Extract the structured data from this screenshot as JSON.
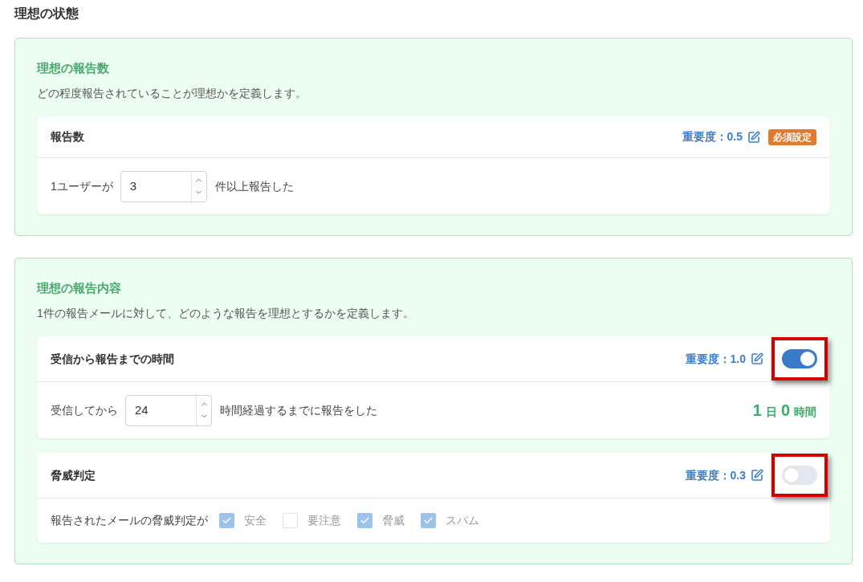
{
  "page_title": "理想の状態",
  "sections": [
    {
      "title": "理想の報告数",
      "description": "どの程度報告されていることが理想かを定義します。",
      "cards": [
        {
          "title": "報告数",
          "importance": "重要度：0.5",
          "badge": "必須設定",
          "body": {
            "kind": "number",
            "prefix": "1ユーザーが",
            "value": "3",
            "suffix": "件以上報告した"
          }
        }
      ]
    },
    {
      "title": "理想の報告内容",
      "description": "1件の報告メールに対して、どのような報告を理想とするかを定義します。",
      "cards": [
        {
          "title": "受信から報告までの時間",
          "importance": "重要度：1.0",
          "toggle": {
            "on": true,
            "highlighted": true
          },
          "body": {
            "kind": "number",
            "prefix": "受信してから",
            "value": "24",
            "suffix": "時間経過するまでに報告をした",
            "duration": [
              {
                "value": "1",
                "unit": "日"
              },
              {
                "value": "0",
                "unit": "時間"
              }
            ]
          }
        },
        {
          "title": "脅威判定",
          "importance": "重要度：0.3",
          "toggle": {
            "on": false,
            "highlighted": true
          },
          "body": {
            "kind": "checkboxes",
            "prefix": "報告されたメールの脅威判定が",
            "options": [
              {
                "label": "安全",
                "checked": true
              },
              {
                "label": "要注意",
                "checked": false
              },
              {
                "label": "脅威",
                "checked": true
              },
              {
                "label": "スパム",
                "checked": true
              }
            ]
          }
        }
      ]
    }
  ]
}
